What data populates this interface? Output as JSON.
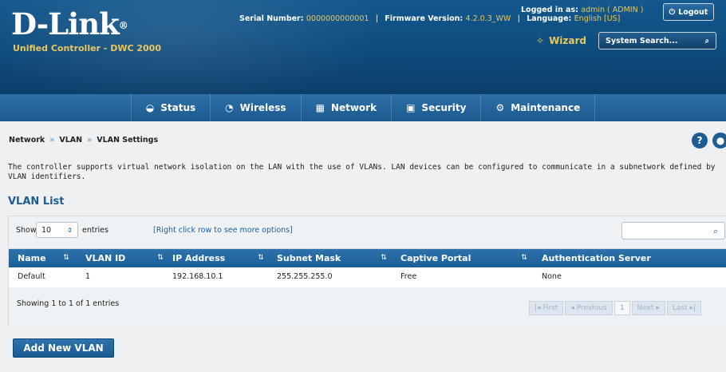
{
  "brand": {
    "logo": "D-Link",
    "registered": "®",
    "product": "Unified Controller - DWC 2000"
  },
  "header": {
    "serial_label": "Serial Number:",
    "serial_value": "0000000000001",
    "firmware_label": "Firmware Version:",
    "firmware_value": "4.2.0.3_WW",
    "language_label": "Language:",
    "language_value": "English [US]",
    "logged_label": "Logged in as:",
    "logged_value": "admin ( ADMIN )",
    "logout": "Logout",
    "wizard": "Wizard",
    "search_placeholder": "System Search..."
  },
  "nav": [
    "Status",
    "Wireless",
    "Network",
    "Security",
    "Maintenance"
  ],
  "breadcrumb": [
    "Network",
    "VLAN",
    "VLAN Settings"
  ],
  "description": "The controller supports virtual network isolation on the LAN with the use of VLANs. LAN devices can be configured to communicate in a subnetwork defined by VLAN identifiers.",
  "section_title": "VLAN List",
  "table": {
    "show": "Show",
    "entries_count": "10",
    "entries": "entries",
    "hint": "[Right click row to see more options]",
    "columns": [
      "Name",
      "VLAN ID",
      "IP Address",
      "Subnet Mask",
      "Captive Portal",
      "Authentication Server"
    ],
    "rows": [
      [
        "Default",
        "1",
        "192.168.10.1",
        "255.255.255.0",
        "Free",
        "None"
      ]
    ],
    "showing": "Showing 1 to 1 of 1 entries",
    "pagination": {
      "first": "First",
      "previous": "Previous",
      "current": "1",
      "next": "Next",
      "last": "Last"
    }
  },
  "add_button": "Add New VLAN",
  "colors": {
    "header_blue": "#0e4b7c",
    "accent_gold": "#e7c85c",
    "table_head": "#1c5e97"
  },
  "icons": [
    "status-icon",
    "wireless-icon",
    "network-icon",
    "security-icon",
    "maintenance-icon",
    "search-icon",
    "wizard-icon",
    "help-icon",
    "power-icon"
  ]
}
